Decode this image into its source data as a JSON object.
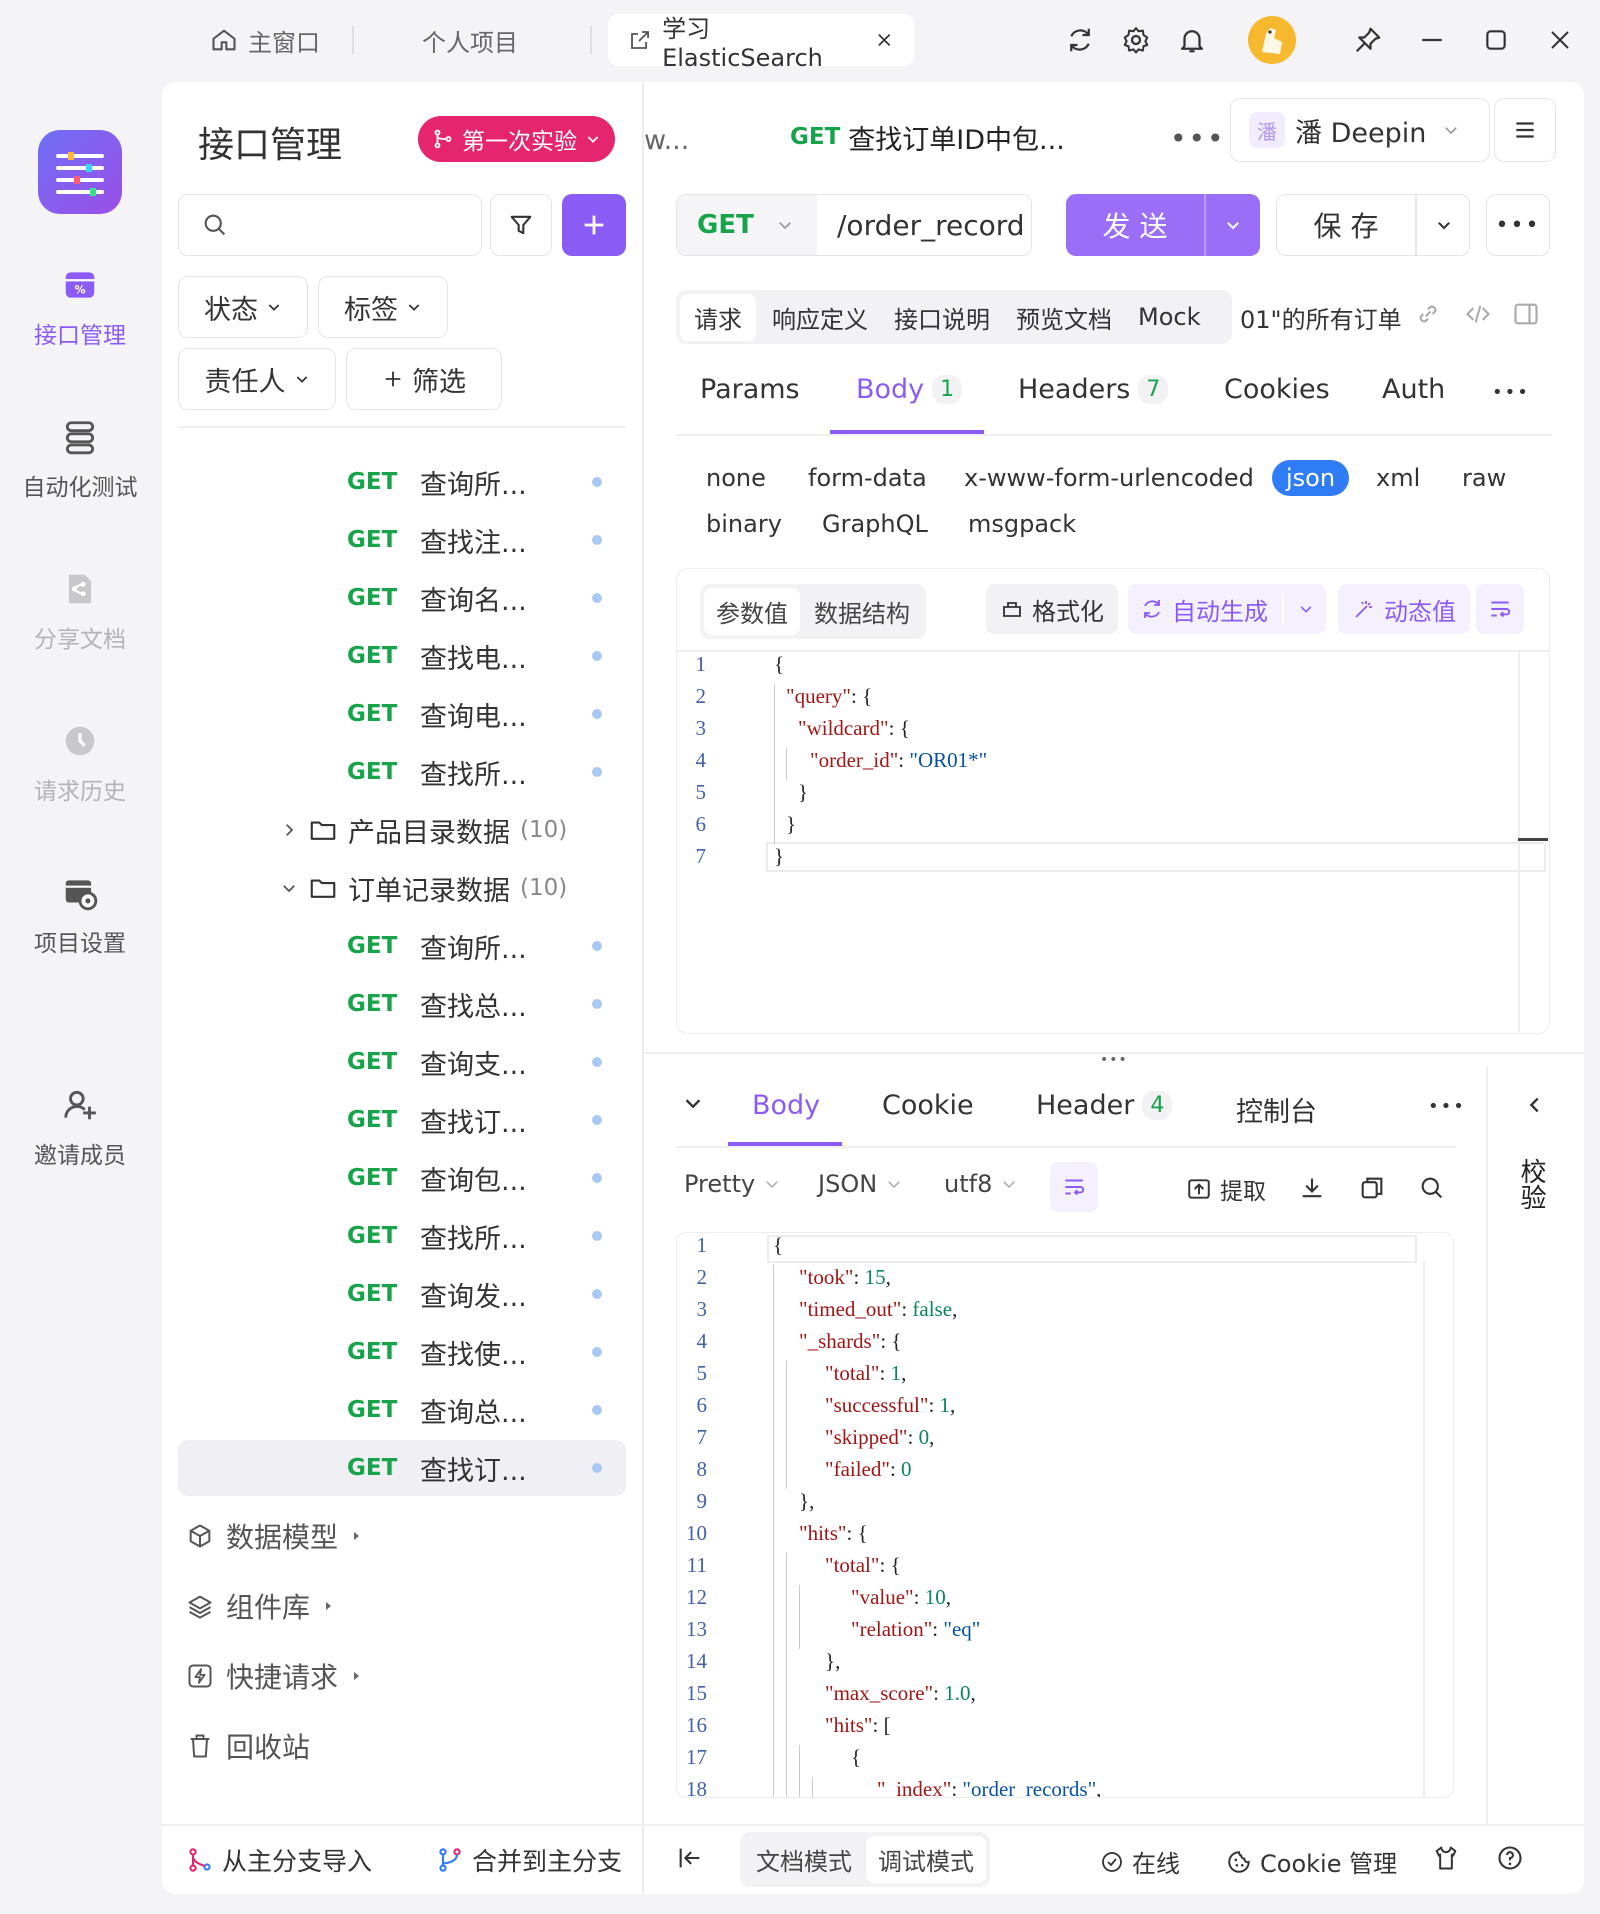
{
  "window": {
    "tabs": [
      {
        "label": "主窗口",
        "icon": "home-icon"
      },
      {
        "label": "个人项目"
      },
      {
        "label": "学习ElasticSearch",
        "icon": "external-link-icon",
        "active": true
      }
    ]
  },
  "rail": {
    "items": [
      {
        "label": "接口管理",
        "icon": "api-icon",
        "state": "active"
      },
      {
        "label": "自动化测试",
        "icon": "stack-icon",
        "state": "normal"
      },
      {
        "label": "分享文档",
        "icon": "doc-share-icon",
        "state": "dim"
      },
      {
        "label": "请求历史",
        "icon": "history-icon",
        "state": "dim"
      },
      {
        "label": "项目设置",
        "icon": "project-settings-icon",
        "state": "normal"
      },
      {
        "label": "邀请成员",
        "icon": "add-user-icon",
        "state": "normal"
      }
    ]
  },
  "tree": {
    "title": "接口管理",
    "branch": "第一次实验",
    "filters": {
      "status": "状态",
      "tags": "标签",
      "owner": "责任人",
      "add_filter": "筛选"
    },
    "items_top": [
      {
        "method": "GET",
        "name": "查询所..."
      },
      {
        "method": "GET",
        "name": "查找注..."
      },
      {
        "method": "GET",
        "name": "查询名..."
      },
      {
        "method": "GET",
        "name": "查找电..."
      },
      {
        "method": "GET",
        "name": "查询电..."
      },
      {
        "method": "GET",
        "name": "查找所..."
      }
    ],
    "folders": [
      {
        "name": "产品目录数据",
        "count": "(10)",
        "expanded": false
      },
      {
        "name": "订单记录数据",
        "count": "(10)",
        "expanded": true
      }
    ],
    "items_orders": [
      {
        "method": "GET",
        "name": "查询所..."
      },
      {
        "method": "GET",
        "name": "查找总..."
      },
      {
        "method": "GET",
        "name": "查询支..."
      },
      {
        "method": "GET",
        "name": "查找订..."
      },
      {
        "method": "GET",
        "name": "查询包..."
      },
      {
        "method": "GET",
        "name": "查找所..."
      },
      {
        "method": "GET",
        "name": "查询发..."
      },
      {
        "method": "GET",
        "name": "查找使..."
      },
      {
        "method": "GET",
        "name": "查询总..."
      },
      {
        "method": "GET",
        "name": "查找订...",
        "selected": true
      }
    ],
    "sections": [
      {
        "label": "数据模型",
        "icon": "cube-icon"
      },
      {
        "label": "组件库",
        "icon": "layers-icon"
      },
      {
        "label": "快捷请求",
        "icon": "bolt-icon"
      },
      {
        "label": "回收站",
        "icon": "trash-icon"
      }
    ],
    "footer": {
      "import": "从主分支导入",
      "merge": "合并到主分支"
    }
  },
  "editor": {
    "prev_tab": "w...",
    "tab_method": "GET",
    "tab_title": "查找订单ID中包...",
    "env_avatar": "潘",
    "env": "潘 Deepin",
    "method": "GET",
    "url": "/order_record",
    "send": "发 送",
    "save": "保 存",
    "subtabs": [
      "请求",
      "响应定义",
      "接口说明",
      "预览文档",
      "Mock"
    ],
    "desc_snippet": "01\"的所有订单",
    "param_tabs": [
      {
        "label": "Params",
        "badge": ""
      },
      {
        "label": "Body",
        "badge": "1"
      },
      {
        "label": "Headers",
        "badge": "7"
      },
      {
        "label": "Cookies",
        "badge": ""
      },
      {
        "label": "Auth",
        "badge": ""
      }
    ],
    "body_types": [
      "none",
      "form-data",
      "x-www-form-urlencoded",
      "json",
      "xml",
      "raw",
      "binary",
      "GraphQL",
      "msgpack"
    ],
    "body_selected": "json",
    "body_toolbar": {
      "values": "参数值",
      "schema": "数据结构",
      "format": "格式化",
      "autogen": "自动生成",
      "dynamic": "动态值"
    },
    "request_lines": [
      "{",
      "  \"query\": {",
      "    \"wildcard\": {",
      "      \"order_id\": \"OR01*\"",
      "    }",
      "  }",
      "}"
    ]
  },
  "response": {
    "tabs": [
      {
        "label": "Body",
        "badge": ""
      },
      {
        "label": "Cookie",
        "badge": ""
      },
      {
        "label": "Header",
        "badge": "4"
      },
      {
        "label": "控制台",
        "badge": ""
      }
    ],
    "pretty": "Pretty",
    "format": "JSON",
    "encoding": "utf8",
    "extract": "提取",
    "side_label": "校验",
    "lines": [
      "{",
      "    \"took\": 15,",
      "    \"timed_out\": false,",
      "    \"_shards\": {",
      "        \"total\": 1,",
      "        \"successful\": 1,",
      "        \"skipped\": 0,",
      "        \"failed\": 0",
      "    },",
      "    \"hits\": {",
      "        \"total\": {",
      "            \"value\": 10,",
      "            \"relation\": \"eq\"",
      "        },",
      "        \"max_score\": 1.0,",
      "        \"hits\": [",
      "            {",
      "                \"_index\": \"order_records\","
    ]
  },
  "statusbar": {
    "doc_mode": "文档模式",
    "debug_mode": "调试模式",
    "online": "在线",
    "cookie": "Cookie 管理"
  },
  "colors": {
    "accent": "#8a5cf5",
    "get": "#17a34a",
    "branch": "#e5266e",
    "selected_chip": "#2f7cf6"
  }
}
